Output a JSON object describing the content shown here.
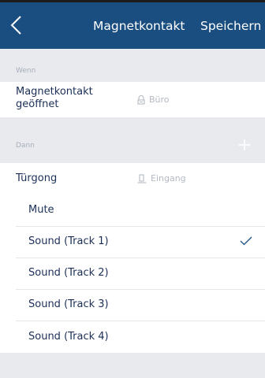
{
  "nav": {
    "title": "Magnetkontakt",
    "save_label": "Speichern"
  },
  "wenn": {
    "section_label": "Wenn",
    "trigger": {
      "label": "Magnetkontakt geöffnet",
      "label_line1": "Magnetkontakt",
      "label_line2": "geöffnet",
      "room": "Büro",
      "room_icon": "door-sensor-icon"
    }
  },
  "dann": {
    "section_label": "Dann",
    "action": {
      "label": "Türgong",
      "location": "Eingang",
      "location_icon": "chime-icon"
    },
    "options": [
      {
        "label": "Mute",
        "selected": false
      },
      {
        "label": "Sound (Track 1)",
        "selected": true
      },
      {
        "label": "Sound (Track 2)",
        "selected": false
      },
      {
        "label": "Sound (Track 3)",
        "selected": false
      },
      {
        "label": "Sound (Track 4)",
        "selected": false
      }
    ]
  },
  "colors": {
    "nav_background": "#1a4e80",
    "text_primary": "#1b2f56",
    "text_secondary": "#b4bac4",
    "check": "#1a4e80"
  }
}
